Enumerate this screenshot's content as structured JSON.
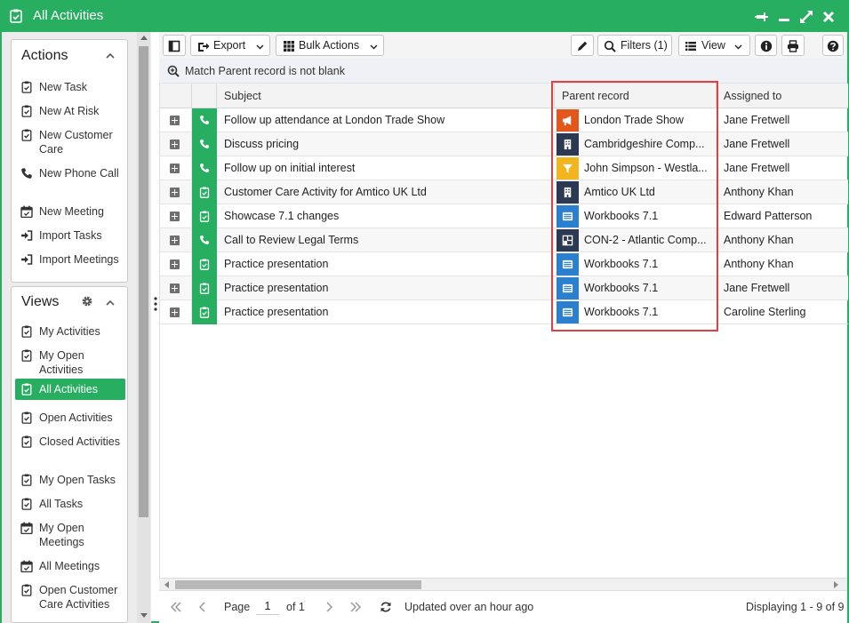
{
  "window": {
    "title": "All Activities",
    "accent_color": "#27ae60",
    "title_icons": [
      "pin-icon",
      "minimize-icon",
      "maximize-icon",
      "close-icon"
    ]
  },
  "actions_panel": {
    "heading": "Actions",
    "items": [
      {
        "label": "New Task",
        "icon": "clipboard-check-icon"
      },
      {
        "label": "New At Risk",
        "icon": "clipboard-check-icon"
      },
      {
        "label": "New Customer Care",
        "icon": "clipboard-check-icon"
      },
      {
        "label": "New Phone Call",
        "icon": "phone-icon"
      },
      {
        "label": "New Meeting",
        "icon": "calendar-icon"
      },
      {
        "label": "Import Tasks",
        "icon": "import-icon"
      },
      {
        "label": "Import Meetings",
        "icon": "import-icon"
      }
    ]
  },
  "views_panel": {
    "heading": "Views",
    "items": [
      {
        "label": "My Activities",
        "icon": "clipboard-check-icon"
      },
      {
        "label": "My Open Activities",
        "icon": "clipboard-check-icon"
      },
      {
        "label": "All Activities",
        "icon": "clipboard-check-icon",
        "selected": true
      },
      {
        "label": "Open Activities",
        "icon": "clipboard-check-icon"
      },
      {
        "label": "Closed Activities",
        "icon": "clipboard-check-icon"
      },
      {
        "label": "My Open Tasks",
        "icon": "clipboard-check-icon"
      },
      {
        "label": "All Tasks",
        "icon": "clipboard-check-icon"
      },
      {
        "label": "My Open Meetings",
        "icon": "calendar-icon"
      },
      {
        "label": "All Meetings",
        "icon": "calendar-icon"
      },
      {
        "label": "Open Customer Care Activities",
        "icon": "clipboard-check-icon"
      }
    ]
  },
  "toolbar": {
    "export_label": "Export",
    "bulk_actions_label": "Bulk Actions",
    "filters_label": "Filters (1)",
    "view_label": "View"
  },
  "filter": {
    "text": "Match Parent record is not blank"
  },
  "grid": {
    "columns": {
      "subject": "Subject",
      "parent": "Parent record",
      "assigned": "Assigned to"
    },
    "highlight_color": "#e0403f",
    "rows": [
      {
        "type": "phone",
        "subject": "Follow up attendance at London Trade Show",
        "parent": "London Trade Show",
        "parent_kind": "campaign",
        "assigned": "Jane Fretwell"
      },
      {
        "type": "phone",
        "subject": "Discuss pricing",
        "parent": "Cambridgeshire Comp...",
        "parent_kind": "organisation",
        "assigned": "Jane Fretwell"
      },
      {
        "type": "phone",
        "subject": "Follow up on initial interest",
        "parent": "John Simpson - Westla...",
        "parent_kind": "lead",
        "assigned": "Jane Fretwell"
      },
      {
        "type": "task",
        "subject": "Customer Care Activity for Amtico UK Ltd",
        "parent": "Amtico UK Ltd",
        "parent_kind": "organisation",
        "assigned": "Anthony Khan"
      },
      {
        "type": "task",
        "subject": "Showcase 7.1 changes",
        "parent": "Workbooks 7.1",
        "parent_kind": "release",
        "assigned": "Edward Patterson"
      },
      {
        "type": "phone",
        "subject": "Call to Review Legal Terms",
        "parent": "CON-2 - Atlantic Comp...",
        "parent_kind": "contract",
        "assigned": "Anthony Khan"
      },
      {
        "type": "task",
        "subject": "Practice presentation",
        "parent": "Workbooks 7.1",
        "parent_kind": "release",
        "assigned": "Anthony Khan"
      },
      {
        "type": "task",
        "subject": "Practice presentation",
        "parent": "Workbooks 7.1",
        "parent_kind": "release",
        "assigned": "Jane Fretwell"
      },
      {
        "type": "task",
        "subject": "Practice presentation",
        "parent": "Workbooks 7.1",
        "parent_kind": "release",
        "assigned": "Caroline Sterling"
      }
    ]
  },
  "pager": {
    "page_label": "Page",
    "page_value": "1",
    "of_label": "of 1",
    "updated": "Updated over an hour ago",
    "displaying": "Displaying 1 - 9 of 9"
  }
}
